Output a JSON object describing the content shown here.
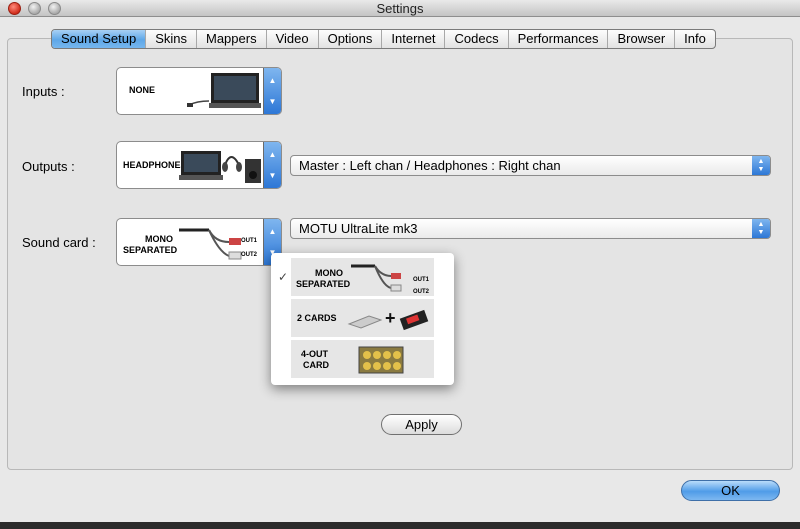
{
  "window": {
    "title": "Settings"
  },
  "tabs": [
    {
      "label": "Sound Setup",
      "active": true
    },
    {
      "label": "Skins"
    },
    {
      "label": "Mappers"
    },
    {
      "label": "Video"
    },
    {
      "label": "Options"
    },
    {
      "label": "Internet"
    },
    {
      "label": "Codecs"
    },
    {
      "label": "Performances"
    },
    {
      "label": "Browser"
    },
    {
      "label": "Info"
    }
  ],
  "inputs": {
    "label": "Inputs :",
    "picker_text": "NONE"
  },
  "outputs": {
    "label": "Outputs :",
    "picker_text": "HEADPHONES",
    "select_value": "Master : Left chan / Headphones : Right chan"
  },
  "sound_card": {
    "label": "Sound card :",
    "picker_line1": "MONO",
    "picker_line2": "SEPARATED",
    "out1": "OUT1",
    "out2": "OUT2",
    "select_value": "MOTU UltraLite mk3"
  },
  "menu": {
    "items": [
      {
        "line1": "MONO",
        "line2": "SEPARATED",
        "out1": "OUT1",
        "out2": "OUT2",
        "checked": true
      },
      {
        "line1": "2 CARDS"
      },
      {
        "line1": "4-OUT",
        "line2": "CARD"
      }
    ],
    "check_glyph": "✓"
  },
  "buttons": {
    "apply": "Apply",
    "ok": "OK"
  },
  "colors": {
    "accent": "#4f9ce8",
    "tab_active": "#5ea7e8",
    "close": "#d12d1c"
  }
}
